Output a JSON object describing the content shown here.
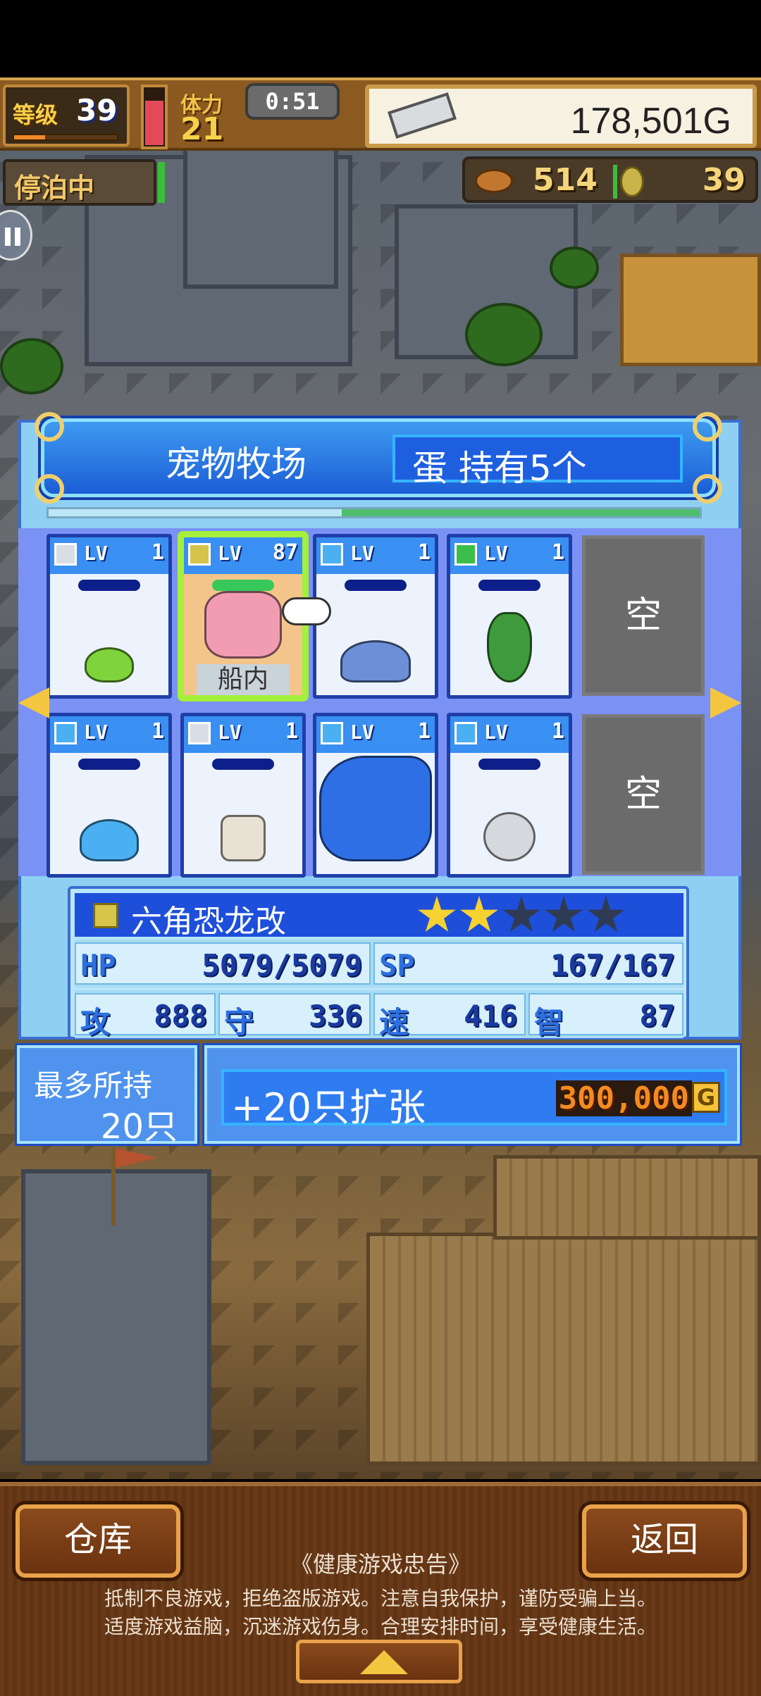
{
  "hud": {
    "level_label": "等级",
    "level": "39",
    "level_progress": 0.3,
    "hp_fill": 0.75,
    "stamina_label": "体力",
    "stamina": "21",
    "timer": "0:51",
    "gold": "178,501G",
    "status": "停泊中",
    "food": "514",
    "seeds": "39"
  },
  "panel": {
    "title": "宠物牧场",
    "egg_text": "蛋 持有5个",
    "progress_fill": 0.55
  },
  "slots": [
    {
      "lv_label": "LV",
      "lv": "1",
      "element_color": "#d9dde6",
      "pet": "slime-icon",
      "pet_color": "#7fd33b"
    },
    {
      "lv_label": "LV",
      "lv": "87",
      "element_color": "#d6c44a",
      "pet": "dinosaur-icon",
      "pet_color": "#f29cb2",
      "selected": true,
      "ship_label": "船内"
    },
    {
      "lv_label": "LV",
      "lv": "1",
      "element_color": "#4ab0f2",
      "pet": "turtle-icon",
      "pet_color": "#6c8fd8"
    },
    {
      "lv_label": "LV",
      "lv": "1",
      "element_color": "#3bbf4a",
      "pet": "plant-icon",
      "pet_color": "#3e9a3a"
    },
    {
      "empty_label": "空"
    },
    {
      "lv_label": "LV",
      "lv": "1",
      "element_color": "#4ab0f2",
      "pet": "water-slime-icon",
      "pet_color": "#4ab0f2"
    },
    {
      "lv_label": "LV",
      "lv": "1",
      "element_color": "#d9dde6",
      "pet": "dog-icon",
      "pet_color": "#e8e2d4"
    },
    {
      "lv_label": "LV",
      "lv": "1",
      "element_color": "#4ab0f2",
      "pet": "sea-dragon-icon",
      "pet_color": "#2e6fe6"
    },
    {
      "lv_label": "LV",
      "lv": "1",
      "element_color": "#4ab0f2",
      "pet": "urchin-icon",
      "pet_color": "#d5d8dc"
    },
    {
      "empty_label": "空"
    }
  ],
  "stats": {
    "name": "六角恐龙改",
    "stars_filled": 2,
    "stars_total": 5,
    "hp_label": "HP",
    "hp": "5079/5079",
    "sp_label": "SP",
    "sp": "167/167",
    "atk_label": "攻",
    "atk": "888",
    "def_label": "守",
    "def": "336",
    "spd_label": "速",
    "spd": "416",
    "int_label": "智",
    "int": "87"
  },
  "capacity": {
    "label": "最多所持",
    "value": "20只"
  },
  "expand": {
    "label": "+20只扩张",
    "price": "300,000",
    "currency": "G"
  },
  "bottom": {
    "warehouse": "仓库",
    "back": "返回",
    "notice_title": "《健康游戏忠告》",
    "notice_line1": "抵制不良游戏，拒绝盗版游戏。注意自我保护，谨防受骗上当。",
    "notice_line2": "适度游戏益脑，沉迷游戏伤身。合理安排时间，享受健康生活。"
  }
}
